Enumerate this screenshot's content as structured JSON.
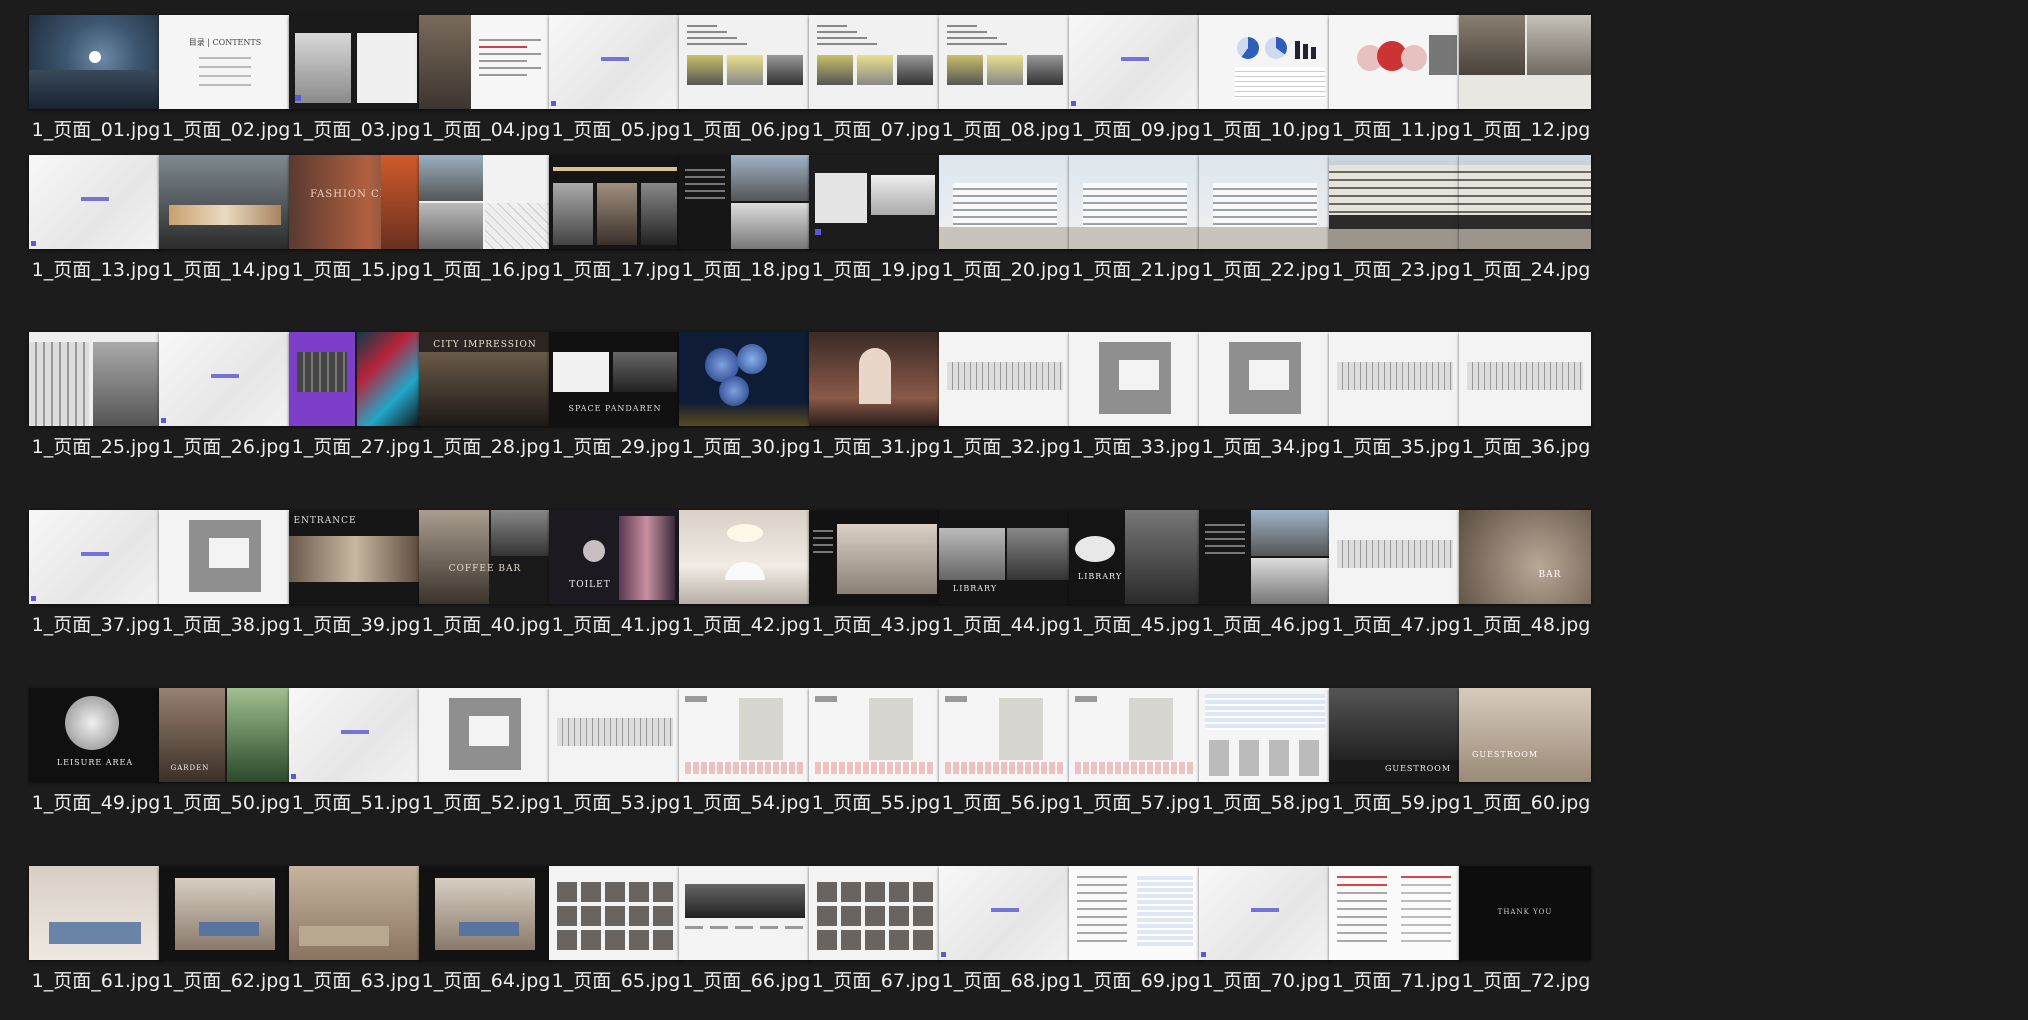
{
  "folder": {
    "view": "large-icons",
    "files": [
      {
        "name": "1_页面_01.jpg",
        "theme": "aerial",
        "caption": ""
      },
      {
        "name": "1_页面_02.jpg",
        "theme": "toc",
        "caption": "目录 | CONTENTS"
      },
      {
        "name": "1_页面_03.jpg",
        "theme": "building-dark",
        "caption": ""
      },
      {
        "name": "1_页面_04.jpg",
        "theme": "photo-text",
        "caption": ""
      },
      {
        "name": "1_页面_05.jpg",
        "theme": "divider",
        "caption": ""
      },
      {
        "name": "1_页面_06.jpg",
        "theme": "text-photos",
        "caption": ""
      },
      {
        "name": "1_页面_07.jpg",
        "theme": "text-photos",
        "caption": ""
      },
      {
        "name": "1_页面_08.jpg",
        "theme": "text-photos",
        "caption": ""
      },
      {
        "name": "1_页面_09.jpg",
        "theme": "divider",
        "caption": ""
      },
      {
        "name": "1_页面_10.jpg",
        "theme": "chart",
        "caption": ""
      },
      {
        "name": "1_页面_11.jpg",
        "theme": "circles",
        "caption": ""
      },
      {
        "name": "1_页面_12.jpg",
        "theme": "people",
        "caption": ""
      },
      {
        "name": "1_页面_13.jpg",
        "theme": "divider",
        "caption": ""
      },
      {
        "name": "1_页面_14.jpg",
        "theme": "street",
        "caption": ""
      },
      {
        "name": "1_页面_15.jpg",
        "theme": "fashion",
        "caption": "FASHION CITY"
      },
      {
        "name": "1_页面_16.jpg",
        "theme": "map",
        "caption": ""
      },
      {
        "name": "1_页面_17.jpg",
        "theme": "dark-text",
        "caption": ""
      },
      {
        "name": "1_页面_18.jpg",
        "theme": "dark-photos",
        "caption": ""
      },
      {
        "name": "1_页面_19.jpg",
        "theme": "plan-photo",
        "caption": ""
      },
      {
        "name": "1_页面_20.jpg",
        "theme": "render",
        "caption": ""
      },
      {
        "name": "1_页面_21.jpg",
        "theme": "render",
        "caption": ""
      },
      {
        "name": "1_页面_22.jpg",
        "theme": "render",
        "caption": ""
      },
      {
        "name": "1_页面_23.jpg",
        "theme": "render-street",
        "caption": ""
      },
      {
        "name": "1_页面_24.jpg",
        "theme": "render-street",
        "caption": ""
      },
      {
        "name": "1_页面_25.jpg",
        "theme": "facade",
        "caption": ""
      },
      {
        "name": "1_页面_26.jpg",
        "theme": "divider",
        "caption": ""
      },
      {
        "name": "1_页面_27.jpg",
        "theme": "purple",
        "caption": ""
      },
      {
        "name": "1_页面_28.jpg",
        "theme": "city-impression",
        "caption": "CITY IMPRESSION"
      },
      {
        "name": "1_页面_29.jpg",
        "theme": "pandaren",
        "caption": "SPACE PANDAREN"
      },
      {
        "name": "1_页面_30.jpg",
        "theme": "spheres",
        "caption": ""
      },
      {
        "name": "1_页面_31.jpg",
        "theme": "arch",
        "caption": ""
      },
      {
        "name": "1_页面_32.jpg",
        "theme": "elevation",
        "caption": ""
      },
      {
        "name": "1_页面_33.jpg",
        "theme": "plan",
        "caption": ""
      },
      {
        "name": "1_页面_34.jpg",
        "theme": "plan",
        "caption": ""
      },
      {
        "name": "1_页面_35.jpg",
        "theme": "elevation",
        "caption": ""
      },
      {
        "name": "1_页面_36.jpg",
        "theme": "elevation",
        "caption": ""
      },
      {
        "name": "1_页面_37.jpg",
        "theme": "divider",
        "caption": ""
      },
      {
        "name": "1_页面_38.jpg",
        "theme": "plan",
        "caption": ""
      },
      {
        "name": "1_页面_39.jpg",
        "theme": "entrance",
        "caption": "ENTRANCE"
      },
      {
        "name": "1_页面_40.jpg",
        "theme": "coffee",
        "caption": "COFFEE BAR"
      },
      {
        "name": "1_页面_41.jpg",
        "theme": "toilet",
        "caption": "TOILET"
      },
      {
        "name": "1_页面_42.jpg",
        "theme": "lobby",
        "caption": ""
      },
      {
        "name": "1_页面_43.jpg",
        "theme": "lobby-dark",
        "caption": ""
      },
      {
        "name": "1_页面_44.jpg",
        "theme": "library",
        "caption": "LIBRARY"
      },
      {
        "name": "1_页面_45.jpg",
        "theme": "library2",
        "caption": "LIBRARY"
      },
      {
        "name": "1_页面_46.jpg",
        "theme": "dark-photos",
        "caption": ""
      },
      {
        "name": "1_页面_47.jpg",
        "theme": "elevation",
        "caption": ""
      },
      {
        "name": "1_页面_48.jpg",
        "theme": "bar",
        "caption": "BAR"
      },
      {
        "name": "1_页面_49.jpg",
        "theme": "leisure",
        "caption": "LEISURE AREA"
      },
      {
        "name": "1_页面_50.jpg",
        "theme": "garden",
        "caption": "GARDEN"
      },
      {
        "name": "1_页面_51.jpg",
        "theme": "divider",
        "caption": ""
      },
      {
        "name": "1_页面_52.jpg",
        "theme": "plan",
        "caption": ""
      },
      {
        "name": "1_页面_53.jpg",
        "theme": "elevation",
        "caption": ""
      },
      {
        "name": "1_页面_54.jpg",
        "theme": "unit-plan",
        "caption": ""
      },
      {
        "name": "1_页面_55.jpg",
        "theme": "unit-plan",
        "caption": ""
      },
      {
        "name": "1_页面_56.jpg",
        "theme": "unit-plan",
        "caption": ""
      },
      {
        "name": "1_页面_57.jpg",
        "theme": "unit-plan",
        "caption": ""
      },
      {
        "name": "1_页面_58.jpg",
        "theme": "table",
        "caption": ""
      },
      {
        "name": "1_页面_59.jpg",
        "theme": "guestroom",
        "caption": "GUESTROOM"
      },
      {
        "name": "1_页面_60.jpg",
        "theme": "guestroom-light",
        "caption": "GUESTROOM"
      },
      {
        "name": "1_页面_61.jpg",
        "theme": "bedroom",
        "caption": ""
      },
      {
        "name": "1_页面_62.jpg",
        "theme": "bedroom-dark",
        "caption": ""
      },
      {
        "name": "1_页面_63.jpg",
        "theme": "bedroom-warm",
        "caption": ""
      },
      {
        "name": "1_页面_64.jpg",
        "theme": "bedroom-dark",
        "caption": ""
      },
      {
        "name": "1_页面_65.jpg",
        "theme": "grid-photos",
        "caption": ""
      },
      {
        "name": "1_页面_66.jpg",
        "theme": "system",
        "caption": ""
      },
      {
        "name": "1_页面_67.jpg",
        "theme": "grid-photos",
        "caption": ""
      },
      {
        "name": "1_页面_68.jpg",
        "theme": "divider",
        "caption": ""
      },
      {
        "name": "1_页面_69.jpg",
        "theme": "document",
        "caption": ""
      },
      {
        "name": "1_页面_70.jpg",
        "theme": "divider",
        "caption": ""
      },
      {
        "name": "1_页面_71.jpg",
        "theme": "document-red",
        "caption": ""
      },
      {
        "name": "1_页面_72.jpg",
        "theme": "thanks",
        "caption": "THANK YOU"
      }
    ]
  }
}
